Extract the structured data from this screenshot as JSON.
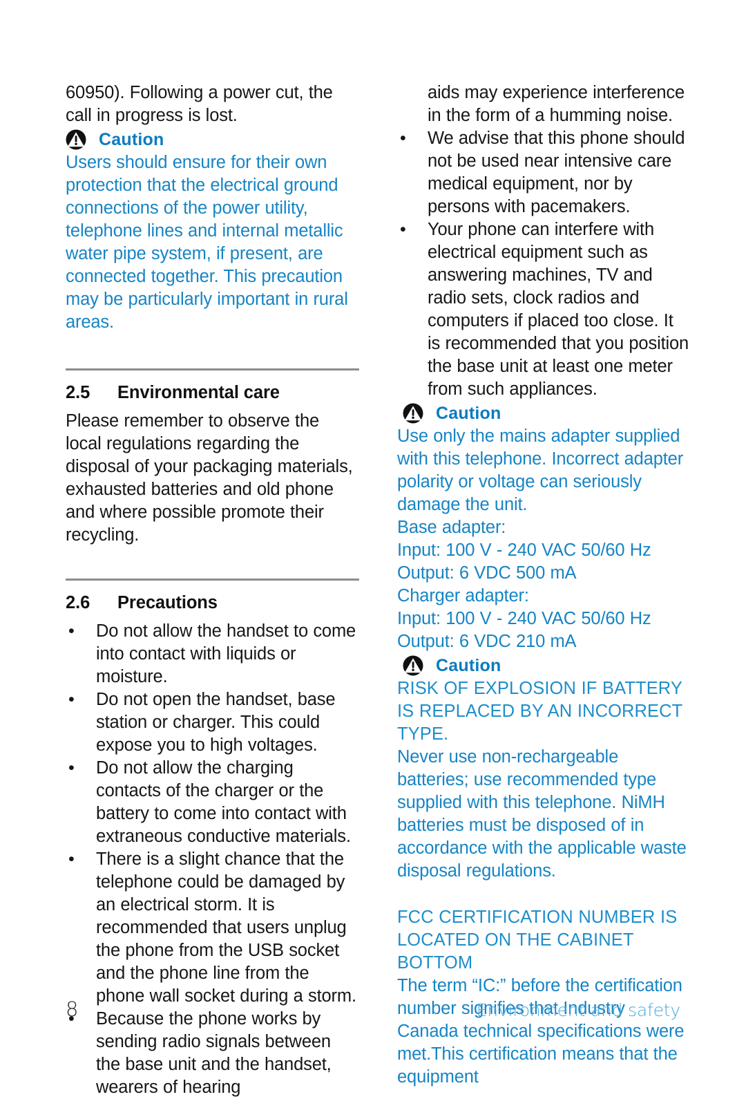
{
  "document": {
    "page_number": "8",
    "footer_title": "Environment and safety",
    "caution_label": "Caution",
    "colors": {
      "caution_blue": "#1684c4",
      "caution_heading_blue": "#0a7cc0",
      "footer_blue": "#4aa9e2",
      "rule_gray": "#8b8b8b",
      "body_black": "#161616"
    },
    "icons": {
      "warning": "warning-triangle-icon"
    }
  },
  "left_column": {
    "continued_paragraph": "60950). Following a power cut, the call in progress is lost.",
    "caution_1": {
      "label": "Caution",
      "body": "Users should ensure for their own protection that the electrical ground connections of the power utility, telephone lines and internal metallic water pipe system, if present, are connected together. This precaution may be particularly important in rural areas."
    },
    "section_2_5": {
      "number": "2.5",
      "title": "Environmental care",
      "body": "Please remember to observe the local regulations regarding the disposal of your packaging materials, exhausted batteries and old phone and where possible promote their recycling."
    },
    "section_2_6": {
      "number": "2.6",
      "title": "Precautions",
      "bullets": [
        "Do not allow the handset to come into contact with liquids or moisture.",
        "Do not open the handset, base station or charger. This could expose you to high voltages.",
        "Do not allow the charging contacts of the charger or the battery to come into contact with extraneous conductive materials.",
        "There is a slight chance that the telephone could be damaged by an electrical storm. It is recommended that users unplug the phone from the USB socket and the phone line from the phone wall socket during a storm.",
        "Because the phone works by sending radio signals between the base unit and the handset, wearers of hearing"
      ]
    }
  },
  "right_column": {
    "continued_bullet": "aids may experience interference in the form of a humming noise.",
    "bullets": [
      "We advise that this phone should not be used near intensive care medical equipment, nor by persons with pacemakers.",
      "Your phone can interfere with electrical equipment such as answering machines, TV and radio sets, clock radios and computers if placed too close. It is recommended that you position the base unit at least one meter from such appliances."
    ],
    "caution_2": {
      "label": "Caution",
      "body": "Use only the mains adapter supplied with this telephone. Incorrect adapter polarity or voltage can seriously damage the unit.",
      "specs": [
        "Base adapter:",
        "Input: 100 V - 240 VAC 50/60 Hz",
        "Output: 6 VDC 500 mA",
        "Charger adapter:",
        "Input: 100 V - 240 VAC 50/60 Hz",
        "Output: 6 VDC 210 mA"
      ]
    },
    "caution_3": {
      "label": "Caution",
      "heading": "RISK OF EXPLOSION IF BATTERY IS REPLACED BY AN INCORRECT TYPE.",
      "body": "Never use non-rechargeable batteries; use recommended type supplied with this telephone. NiMH batteries must be disposed of in accordance with the applicable waste disposal regulations."
    },
    "fcc": {
      "heading": "FCC CERTIFICATION NUMBER IS LOCATED ON THE CABINET BOTTOM",
      "body": "The term “IC:” before the certification number signifies that Industry Canada technical specifications were met.This certification means that the equipment"
    }
  }
}
